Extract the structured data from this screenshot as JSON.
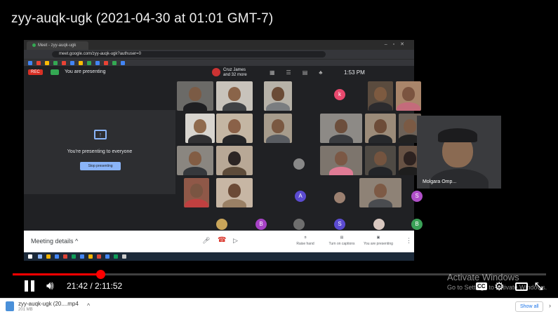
{
  "video": {
    "title": "zyy-auqk-ugk (2021-04-30 at 01:01 GMT-7)",
    "current_time": "21:42",
    "duration": "2:11:52",
    "time_display": "21:42 / 2:11:52",
    "progress": 0.165
  },
  "meet": {
    "rec_label": "REC",
    "presenting_label": "You are presenting",
    "participants_name": "Cruz James",
    "participants_more": "and 32 more",
    "clock": "1:53 PM",
    "presenting_to_everyone": "You're presenting to everyone",
    "stop_presenting": "Stop presenting",
    "meeting_details": "Meeting details ^",
    "raise_hand": "Raise hand",
    "captions": "Turn on captions",
    "you_presenting": "You are presenting",
    "side_participant": "Molgara Omp...",
    "avatars": [
      {
        "letter": "k",
        "color": "#e8496e"
      },
      {
        "letter": "A",
        "color": "#5b4bd1"
      },
      {
        "letter": "S",
        "color": "#b04fc9"
      },
      {
        "letter": "B",
        "color": "#a742c6"
      },
      {
        "letter": "S",
        "color": "#5b4bd1"
      },
      {
        "letter": "B",
        "color": "#3aa157"
      }
    ]
  },
  "browser": {
    "tab_title": "Meet - zyy-auqk-ugk",
    "url": "meet.google.com/zyy-auqk-ugk?authuser=0"
  },
  "overlay": {
    "activate_line1": "Activate Windows",
    "activate_line2": "Go to Settings to activate Windows."
  },
  "player_controls": {
    "cc_label": "CC",
    "pause_icon": "pause-icon",
    "volume_icon": "volume-icon",
    "settings_icon": "gear-icon",
    "fullscreen_icon": "exit-fullscreen-icon"
  },
  "downloads": {
    "file_name": "zyy-auqk-ugk (20....mp4",
    "file_size": "201 MB",
    "show_all": "Show all"
  }
}
